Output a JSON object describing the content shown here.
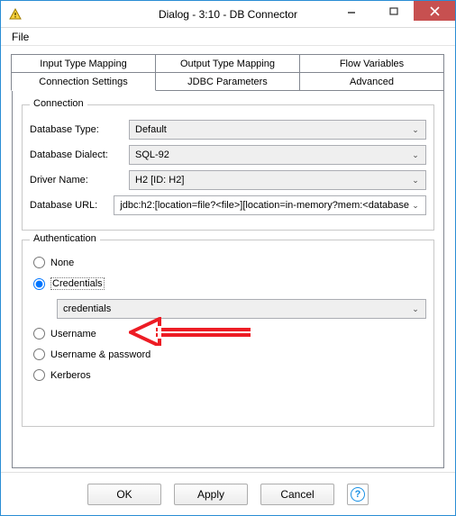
{
  "window": {
    "title": "Dialog - 3:10 - DB Connector"
  },
  "menu": {
    "file": "File"
  },
  "tabs": {
    "input_type_mapping": "Input Type Mapping",
    "output_type_mapping": "Output Type Mapping",
    "flow_variables": "Flow Variables",
    "connection_settings": "Connection Settings",
    "jdbc_parameters": "JDBC Parameters",
    "advanced": "Advanced"
  },
  "connection": {
    "legend": "Connection",
    "db_type_label": "Database Type:",
    "db_type_value": "Default",
    "dialect_label": "Database Dialect:",
    "dialect_value": "SQL-92",
    "driver_label": "Driver Name:",
    "driver_value": "H2 [ID: H2]",
    "url_label": "Database URL:",
    "url_value": "jdbc:h2:[location=file?<file>][location=in-memory?mem:<database"
  },
  "auth": {
    "legend": "Authentication",
    "none": "None",
    "credentials": "Credentials",
    "credentials_value": "credentials",
    "username": "Username",
    "username_password": "Username & password",
    "kerberos": "Kerberos"
  },
  "buttons": {
    "ok": "OK",
    "apply": "Apply",
    "cancel": "Cancel"
  },
  "icons": {
    "chevron": "⌄"
  }
}
